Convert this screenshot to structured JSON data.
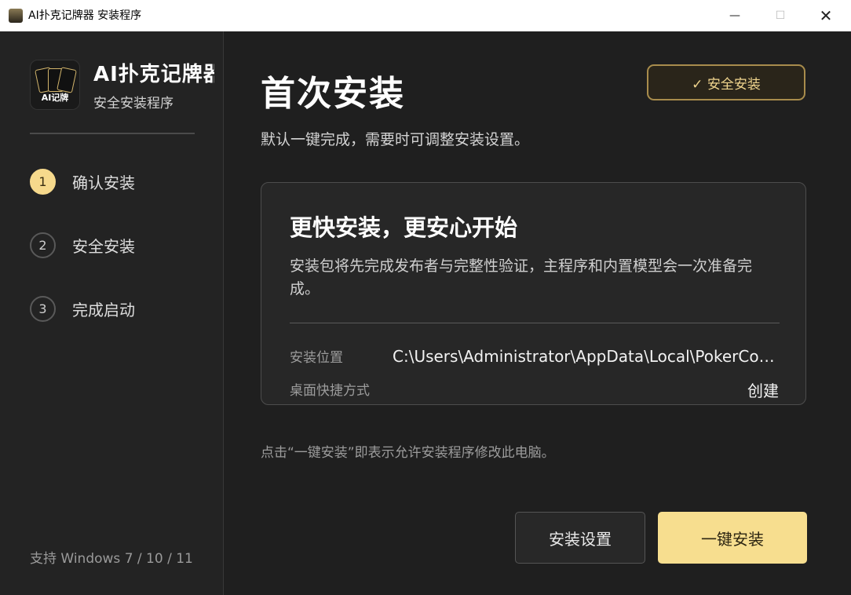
{
  "window": {
    "title": "AI扑克记牌器 安装程序",
    "minimize_glyph": "—",
    "maximize_glyph": "☐",
    "close_glyph": "✕"
  },
  "sidebar": {
    "logo_text": "AI记牌",
    "app_name": "AI扑克记牌器",
    "app_subtitle": "安全安装程序",
    "steps": [
      {
        "num": "1",
        "label": "确认安装",
        "active": true
      },
      {
        "num": "2",
        "label": "安全安装",
        "active": false
      },
      {
        "num": "3",
        "label": "完成启动",
        "active": false
      }
    ],
    "support": "支持 Windows 7 / 10 / 11"
  },
  "main": {
    "heading": "首次安装",
    "subheading": "默认一键完成，需要时可调整安装设置。",
    "badge": "✓ 安全安装",
    "card": {
      "title": "更快安装，更安心开始",
      "description": "安装包将先完成发布者与完整性验证，主程序和内置模型会一次准备完成。",
      "install_location_label": "安装位置",
      "install_location_value": "C:\\Users\\Administrator\\AppData\\Local\\PokerCopilot",
      "shortcut_label": "桌面快捷方式",
      "shortcut_value": "创建"
    },
    "notice": "点击“一键安装”即表示允许安装程序修改此电脑。",
    "settings_button": "安装设置",
    "install_button": "一键安装"
  },
  "colors": {
    "accent": "#f7de8f",
    "badge_border": "#a88c4c",
    "background": "#1f1f1f",
    "sidebar": "#232323"
  },
  "icons": [
    "app-logo-icon",
    "minimize-icon",
    "maximize-icon",
    "close-icon",
    "check-icon"
  ]
}
